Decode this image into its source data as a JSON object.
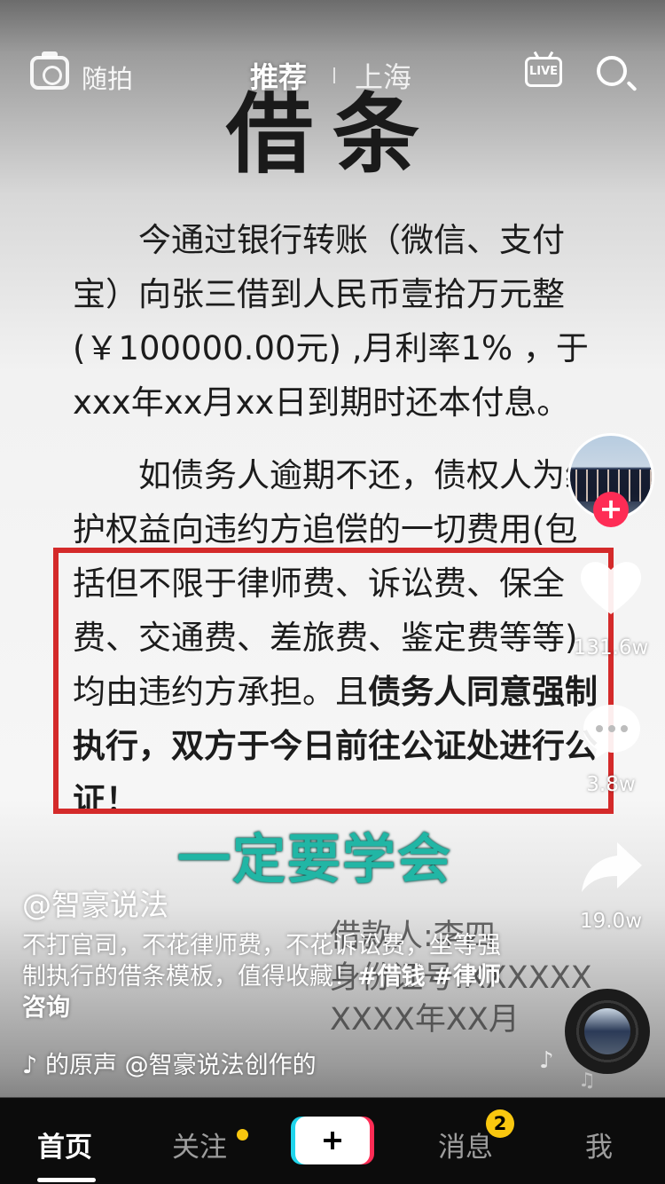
{
  "video": {
    "doc_title": "借条",
    "paragraph1": "今通过银行转账（微信、支付宝）向张三借到人民币壹拾万元整(￥100000.00元) ,月利率1% ，于xxx年xx月xx日到期时还本付息。",
    "paragraph2_plain": "如债务人逾期不还，债权人为维护权益向违约方追偿的一切费用(包括但不限于律师费、诉讼费、保全费、交通费、差旅费、鉴定费等等)均由违约方承担。且",
    "paragraph2_bold": "债务人同意强制执行，双方于今日前往公证处进行公证！",
    "overlay_headline": "一定要学会",
    "signature_lines": [
      "借款人:李四",
      "身份证号:XXXXXX",
      "XXXX年XX月"
    ]
  },
  "topbar": {
    "capture_label": "随拍",
    "tab_recommend": "推荐",
    "tab_location": "上海",
    "live_label": "LIVE"
  },
  "rail": {
    "likes": "131.6w",
    "comments": "3.8w",
    "shares": "19.0w",
    "follow_symbol": "+"
  },
  "caption": {
    "author": "@智豪说法",
    "description": "不打官司，不花律师费，不花诉讼费，坐等强制执行的借条模板，值得收藏！",
    "hashtags": [
      "#借钱",
      "#律师咨询"
    ],
    "music": "的原声    @智豪说法创作的"
  },
  "nav": {
    "home": "首页",
    "follow": "关注",
    "messages": "消息",
    "messages_badge": "2",
    "me": "我",
    "plus_symbol": "+"
  },
  "colors": {
    "accent_red": "#fe2c55",
    "accent_cyan": "#20d5ec",
    "badge_yellow": "#f9c70f",
    "highlight_box": "#d42a2a",
    "headline_teal": "#21b6a5"
  }
}
